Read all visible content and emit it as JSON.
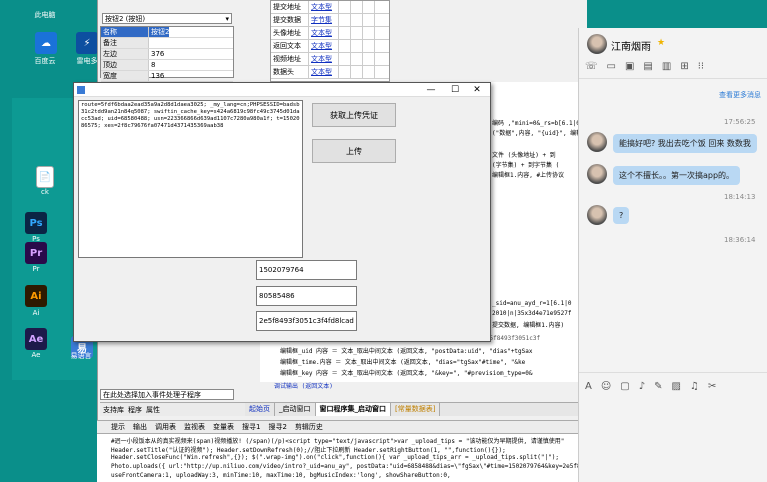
{
  "desktop": {
    "icons": [
      {
        "label": "此电脑",
        "glyph": "",
        "color": "#0a8f8a"
      },
      {
        "label": "百度云",
        "glyph": "☁",
        "color": "#1a72d9"
      },
      {
        "label": "雷电多",
        "glyph": "⚡",
        "color": "#0d4fa0"
      },
      {
        "label": "ck",
        "glyph": "📄",
        "color": "#ffffff"
      },
      {
        "label": "Ps",
        "glyph": "Ps",
        "color": "#0b2545"
      },
      {
        "label": "Pr",
        "glyph": "Pr",
        "color": "#2a0a4a"
      },
      {
        "label": "Ai",
        "glyph": "Ai",
        "color": "#2e1a00"
      },
      {
        "label": "Ae",
        "glyph": "Ae",
        "color": "#1d1a4a"
      },
      {
        "label": "易语言",
        "glyph": "易",
        "color": "#3a7bd5"
      }
    ]
  },
  "ide": {
    "component_select": "按钮2 (按钮)",
    "props": [
      [
        "名称",
        "按钮2"
      ],
      [
        "备注",
        ""
      ],
      [
        "左边",
        "376"
      ],
      [
        "顶边",
        "8"
      ],
      [
        "宽度",
        "136"
      ]
    ],
    "grid": [
      [
        "提交地址",
        "文本型"
      ],
      [
        "提交数据",
        "字节集"
      ],
      [
        "头像地址",
        "文本型"
      ],
      [
        "返回文本",
        "文本型"
      ],
      [
        "视频地址",
        "文本型"
      ],
      [
        "数据头",
        "文本型"
      ]
    ],
    "event_select": "在此处选择加入事件处理子程序",
    "bottom_tabs": [
      "支持库",
      "程序",
      "属性"
    ],
    "code_lines": [
      "编码 ,\"mini=0&_rs=b[6.1|0|85",
      "(\"数据\",内容, \"{uid}\", 编辑",
      "文件 (头像地址) + 到",
      "(字节集) + 到字节集 (",
      "编辑框1.内容, #上传协议",
      "_sid=anu_ayd_r=1[6.1|0",
      "2010|n|35x3d4e71e9527f",
      "提交数据, 编辑框1.内容)",
      "postData: uid=6858488&dias=\"fgSax*\"#time=1502079764akey=2e5f8493f3051c3f",
      "编辑框_uid 内容 ＝ 文本_取出中间文本 (返回文本, \"postData:uid\", \"dias\"+tgSax",
      "编辑框_time.内容 ＝ 文本_取出中间文本 (返回文本, \"dias=\"tgSax\"#time\", \"&ke",
      "编辑框_key 内容 ＝ 文本_取出中间文本 (返回文本, \"&key=\", \"#previsiom_type=0&",
      "调试输出 (返回文本)"
    ],
    "tabs": [
      "起始页",
      "_启动窗口",
      "窗口程序集_启动窗口",
      "[常量数据表]"
    ],
    "output_bar": [
      "提示",
      "输出",
      "调用表",
      "监视表",
      "变量表",
      "搜寻1",
      "搜寻2",
      "剪辑历史"
    ],
    "output_lines": [
      "#迥一小段饭本从的真实视频来(span)视频播放! (/span)(/p)<script type=\"text/javascript\">var _upload_tips = \"该功能仅为早期提供, 请谨慎使用\"",
      "Header.setTitle(\"认证的视频\");          Header.setDownRefresh(0);//阻止下拉刷新 Header.setRightButton(1, \"\",function(){});",
      "Header.setCloseFunc(\"Win.refresh\",{});   $(\".wrap-img\").on(\"click\",function(){          var _upload_tips_arr = _upload_tips.split(\"|\");",
      "     Photo.uploads({               url:\"http://up.niliuo.com/video/intro?_uid=anu_ay\",     postData:\"uid=6858488&dias=\\\"fgSax\\\"#time=1502079764&key=2e5f8493f3051c3f4d",
      "     useFrontCamera:1,              uploadWay:3,              minTime:10,          maxTime:10,          bgMusicIndex:'long',        showShareButton:0,"
    ]
  },
  "dialog": {
    "memo": "route=5fdf6bdaa2ead35a9a2d8d1daea3025; _my_lang=cn;PHPSESSID=badsb31c2tdd9an21n84q5087; swiftin_cache_key=s424a6819c98fc49c3745d01dacc53ad; uid=68580488; usn=223366866d639ad1107c7280a980a1f; t=1502086575; xes=2f8c79676fa07471d4371435369aab38",
    "btn1": "获取上传凭证",
    "btn2": "上传",
    "f1": "1502079764",
    "f2": "80585486",
    "f3": "2e5f8493f3051c3f4fd8lcad"
  },
  "chat": {
    "title": "江南烟雨",
    "star": "★",
    "more": "查看更多消息",
    "time1": "17:56:25",
    "msg1": "能搞好吧? 我出去吃个饭 回来 数数我",
    "msg2": "这个不擅长。。第一次搞app的。",
    "time2": "18:14:13",
    "msg3": "?",
    "time3": "18:36:14"
  }
}
